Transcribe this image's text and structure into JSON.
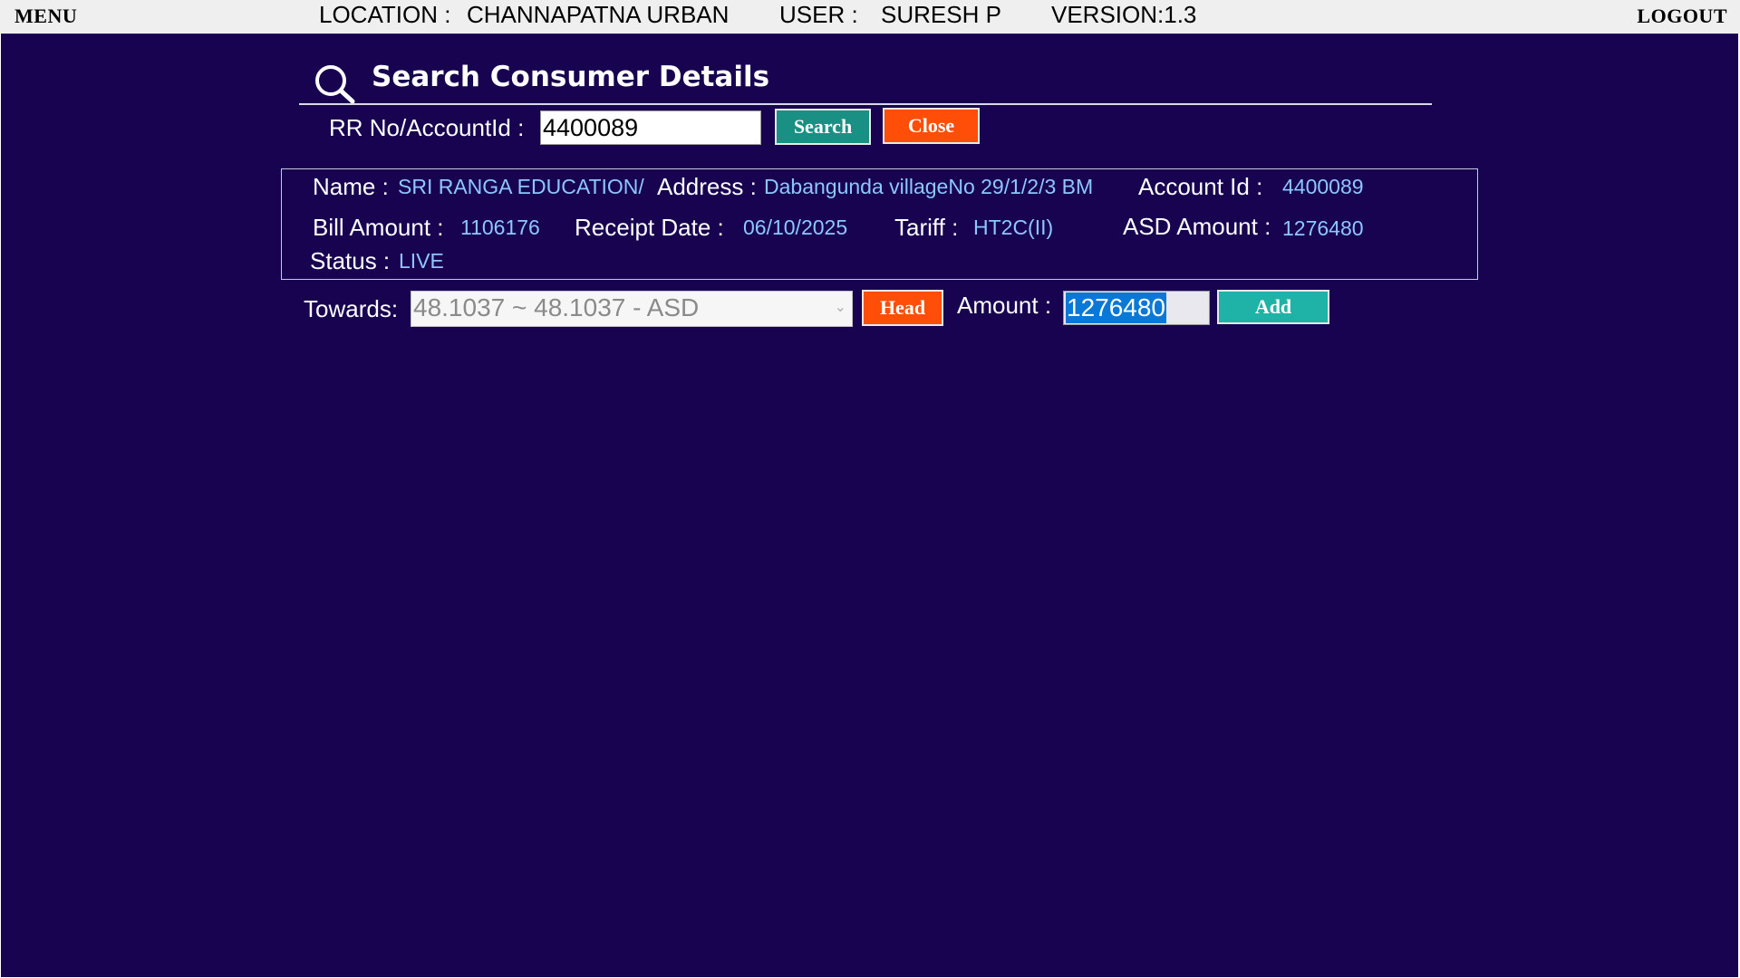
{
  "topbar": {
    "menu": "MENU",
    "location_label": "LOCATION :",
    "location_value": "CHANNAPATNA URBAN",
    "user_label": "USER :",
    "user_value": "SURESH P",
    "version": "VERSION:1.3",
    "logout": "LOGOUT"
  },
  "search": {
    "title": "Search Consumer Details",
    "rr_label": "RR No/AccountId :",
    "rr_value": "4400089",
    "search_button": "Search",
    "close_button": "Close"
  },
  "details": {
    "name_label": "Name :",
    "name_value": "SRI RANGA EDUCATION/",
    "address_label": "Address :",
    "address_value": "Dabangunda villageNo 29/1/2/3 BM",
    "account_label": "Account Id :",
    "account_value": "4400089",
    "bill_label": "Bill Amount :",
    "bill_value": "1106176",
    "receipt_label": "Receipt Date :",
    "receipt_value": "06/10/2025",
    "tariff_label": "Tariff :",
    "tariff_value": "HT2C(II)",
    "asd_label": "ASD Amount :",
    "asd_value": "1276480",
    "status_label": "Status :",
    "status_value": "LIVE"
  },
  "payment": {
    "towards_label": "Towards:",
    "towards_value": "48.1037 ~ 48.1037 - ASD",
    "head_button": "Head",
    "amount_label": "Amount :",
    "amount_value": "1276480",
    "add_button": "Add"
  },
  "icons": {
    "search": "search-icon",
    "dropdown": "chevron-down-icon"
  },
  "colors": {
    "background": "#170350",
    "accent_teal": "#1a8f84",
    "accent_orange": "#ff4e08",
    "value_text": "#8ec6ff"
  }
}
